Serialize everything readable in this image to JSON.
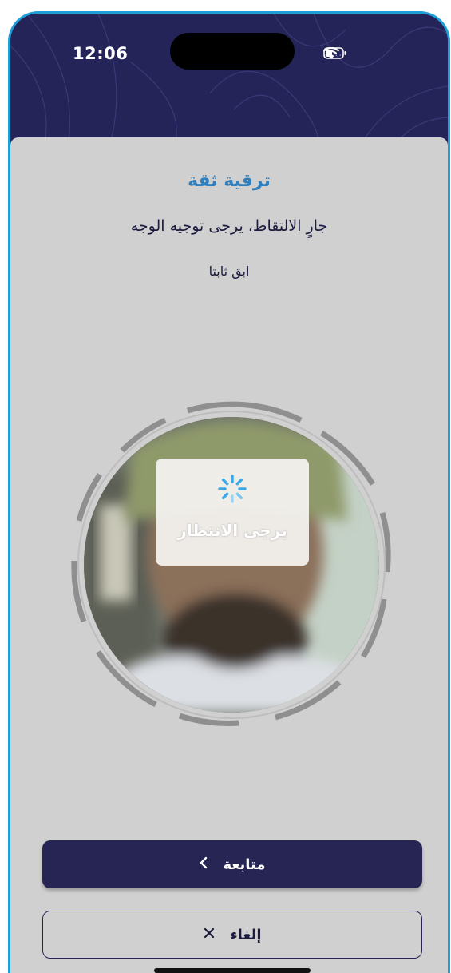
{
  "status_bar": {
    "time": "12:06",
    "signal_dots": "....."
  },
  "screen": {
    "title": "ترقية ثقة",
    "instruction": "جارٍ الالتقاط، يرجى توجيه الوجه",
    "hint": "ابق ثابتا"
  },
  "loading": {
    "label": "يرجى الانتظار"
  },
  "buttons": {
    "continue_label": "متابعة",
    "continue_icon": "chevron-left-icon",
    "cancel_label": "إلغاء",
    "cancel_icon": "close-icon"
  },
  "colors": {
    "header": "#242458",
    "accent": "#2d7fc0",
    "primary_button": "#262554",
    "device_frame": "#1e9fd8",
    "background": "#d0d0d0"
  }
}
